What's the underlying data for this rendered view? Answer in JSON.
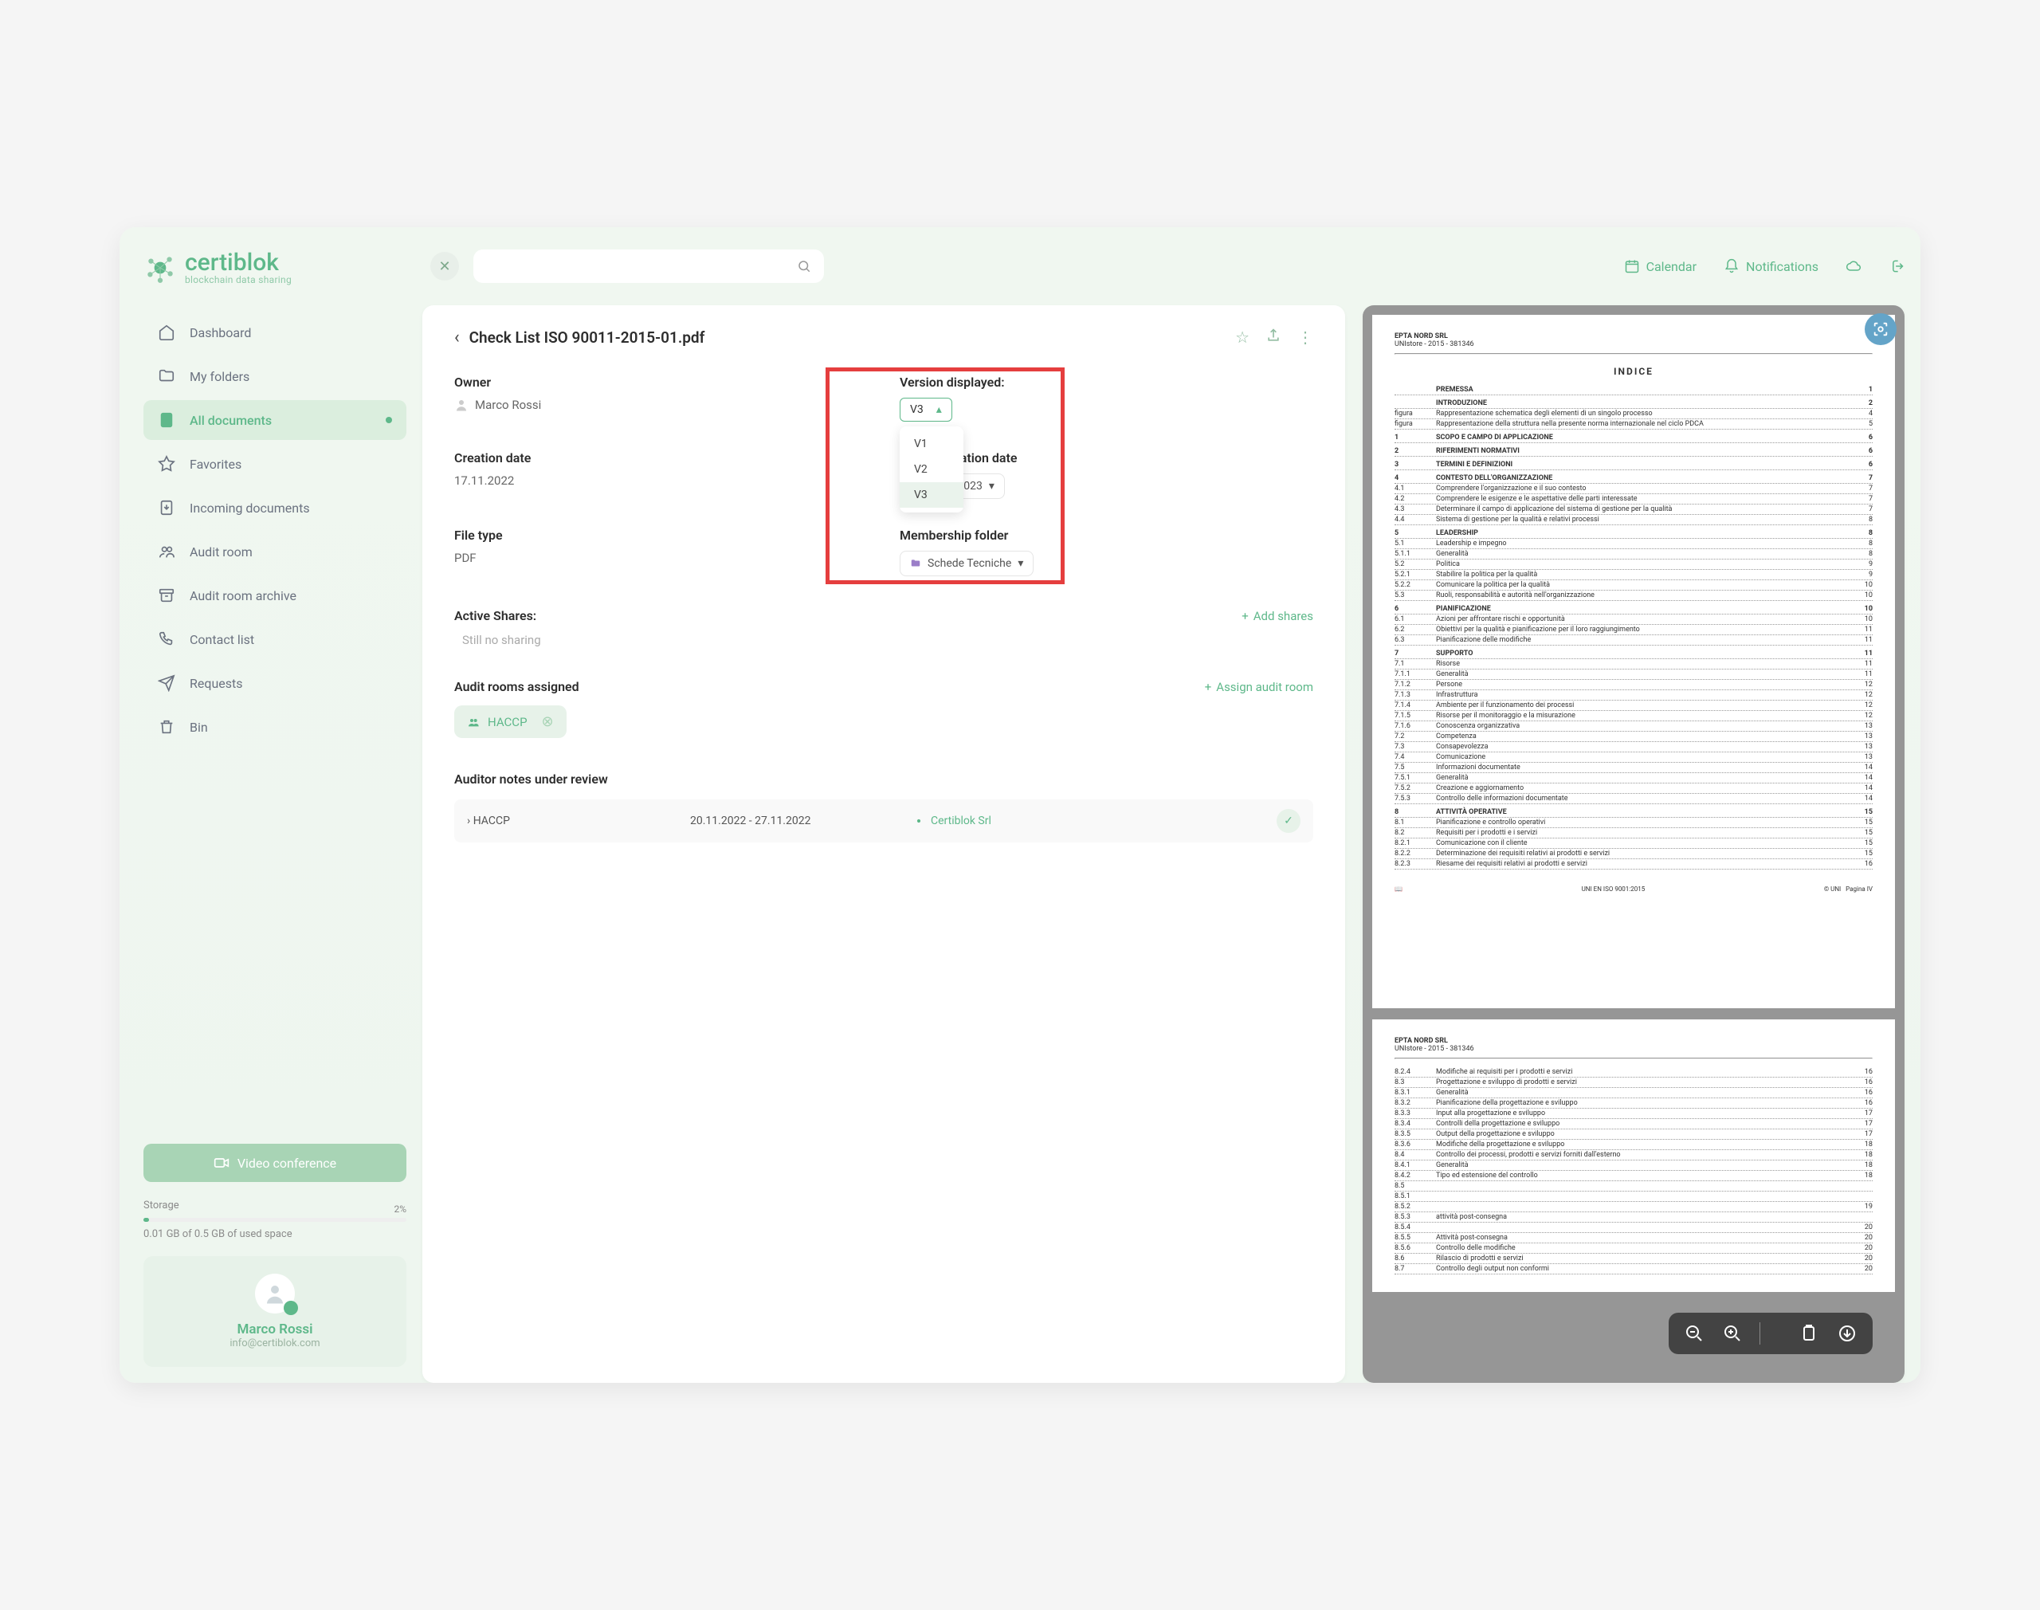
{
  "logo": {
    "name": "certiblok",
    "sub": "blockchain data sharing"
  },
  "nav": [
    {
      "id": "dashboard",
      "label": "Dashboard"
    },
    {
      "id": "folders",
      "label": "My folders"
    },
    {
      "id": "alldocs",
      "label": "All documents",
      "active": true,
      "dot": true
    },
    {
      "id": "favorites",
      "label": "Favorites"
    },
    {
      "id": "incoming",
      "label": "Incoming documents"
    },
    {
      "id": "auditroom",
      "label": "Audit room"
    },
    {
      "id": "archive",
      "label": "Audit room archive"
    },
    {
      "id": "contacts",
      "label": "Contact list"
    },
    {
      "id": "requests",
      "label": "Requests"
    },
    {
      "id": "bin",
      "label": "Bin"
    }
  ],
  "vc_label": "Video conference",
  "storage": {
    "label": "Storage",
    "pct": "2%",
    "text": "0.01 GB of 0.5 GB of used space"
  },
  "profile": {
    "name": "Marco Rossi",
    "email": "info@certiblok.com"
  },
  "topbar": {
    "calendar": "Calendar",
    "notifications": "Notifications"
  },
  "doc": {
    "title": "Check List ISO 90011-2015-01.pdf",
    "owner_label": "Owner",
    "owner": "Marco Rossi",
    "version_label": "Version displayed:",
    "version_selected": "V3",
    "version_options": [
      "V1",
      "V2",
      "V3"
    ],
    "creation_label": "Creation date",
    "creation": "17.11.2022",
    "expiration_label": "Expiration date",
    "expiration": "01.2023",
    "filetype_label": "File type",
    "filetype": "PDF",
    "membership_label": "Membership folder",
    "membership": "Schede Tecniche",
    "shares_label": "Active Shares:",
    "shares_add": "Add shares",
    "shares_none": "Still no sharing",
    "rooms_label": "Audit rooms assigned",
    "rooms_add": "Assign audit room",
    "room_tag": "HACCP",
    "notes_label": "Auditor notes under review",
    "notes": {
      "name": "HACCP",
      "dates": "20.11.2022 - 27.11.2022",
      "company": "Certiblok Srl"
    }
  },
  "preview": {
    "header": "EPTA NORD SRL",
    "subheader": "UNIstore - 2015 - 381346",
    "indice": "INDICE",
    "footer_std": "UNI EN ISO 9001:2015",
    "footer_right": "Pagina IV",
    "footer_uni": "© UNI",
    "toc": [
      {
        "n": "",
        "t": "PREMESSA",
        "p": "1",
        "h": 1
      },
      {
        "n": "",
        "t": "INTRODUZIONE",
        "p": "2",
        "h": 1
      },
      {
        "n": "figura",
        "t": "Rappresentazione schematica degli elementi di un singolo processo",
        "p": "4"
      },
      {
        "n": "figura",
        "t": "Rappresentazione della struttura nella presente norma internazionale nel ciclo PDCA",
        "p": "5"
      },
      {
        "n": "1",
        "t": "SCOPO E CAMPO DI APPLICAZIONE",
        "p": "6",
        "h": 1
      },
      {
        "n": "2",
        "t": "RIFERIMENTI NORMATIVI",
        "p": "6",
        "h": 1
      },
      {
        "n": "3",
        "t": "TERMINI E DEFINIZIONI",
        "p": "6",
        "h": 1
      },
      {
        "n": "4",
        "t": "CONTESTO DELL'ORGANIZZAZIONE",
        "p": "7",
        "h": 1
      },
      {
        "n": "4.1",
        "t": "Comprendere l'organizzazione e il suo contesto",
        "p": "7"
      },
      {
        "n": "4.2",
        "t": "Comprendere le esigenze e le aspettative delle parti interessate",
        "p": "7"
      },
      {
        "n": "4.3",
        "t": "Determinare il campo di applicazione del sistema di gestione per la qualità",
        "p": "7"
      },
      {
        "n": "4.4",
        "t": "Sistema di gestione per la qualità e relativi processi",
        "p": "8"
      },
      {
        "n": "5",
        "t": "LEADERSHIP",
        "p": "8",
        "h": 1
      },
      {
        "n": "5.1",
        "t": "Leadership e impegno",
        "p": "8"
      },
      {
        "n": "5.1.1",
        "t": "Generalità",
        "p": "8"
      },
      {
        "n": "5.2",
        "t": "Politica",
        "p": "9"
      },
      {
        "n": "5.2.1",
        "t": "Stabilire la politica per la qualità",
        "p": "9"
      },
      {
        "n": "5.2.2",
        "t": "Comunicare la politica per la qualità",
        "p": "10"
      },
      {
        "n": "5.3",
        "t": "Ruoli, responsabilità e autorità nell'organizzazione",
        "p": "10"
      },
      {
        "n": "6",
        "t": "PIANIFICAZIONE",
        "p": "10",
        "h": 1
      },
      {
        "n": "6.1",
        "t": "Azioni per affrontare rischi e opportunità",
        "p": "10"
      },
      {
        "n": "6.2",
        "t": "Obiettivi per la qualità e pianificazione per il loro raggiungimento",
        "p": "11"
      },
      {
        "n": "6.3",
        "t": "Pianificazione delle modifiche",
        "p": "11"
      },
      {
        "n": "7",
        "t": "SUPPORTO",
        "p": "11",
        "h": 1
      },
      {
        "n": "7.1",
        "t": "Risorse",
        "p": "11"
      },
      {
        "n": "7.1.1",
        "t": "Generalità",
        "p": "11"
      },
      {
        "n": "7.1.2",
        "t": "Persone",
        "p": "12"
      },
      {
        "n": "7.1.3",
        "t": "Infrastruttura",
        "p": "12"
      },
      {
        "n": "7.1.4",
        "t": "Ambiente per il funzionamento dei processi",
        "p": "12"
      },
      {
        "n": "7.1.5",
        "t": "Risorse per il monitoraggio e la misurazione",
        "p": "12"
      },
      {
        "n": "7.1.6",
        "t": "Conoscenza organizzativa",
        "p": "13"
      },
      {
        "n": "7.2",
        "t": "Competenza",
        "p": "13"
      },
      {
        "n": "7.3",
        "t": "Consapevolezza",
        "p": "13"
      },
      {
        "n": "7.4",
        "t": "Comunicazione",
        "p": "13"
      },
      {
        "n": "7.5",
        "t": "Informazioni documentate",
        "p": "14"
      },
      {
        "n": "7.5.1",
        "t": "Generalità",
        "p": "14"
      },
      {
        "n": "7.5.2",
        "t": "Creazione e aggiornamento",
        "p": "14"
      },
      {
        "n": "7.5.3",
        "t": "Controllo delle informazioni documentate",
        "p": "14"
      },
      {
        "n": "8",
        "t": "ATTIVITÀ OPERATIVE",
        "p": "15",
        "h": 1
      },
      {
        "n": "8.1",
        "t": "Pianificazione e controllo operativi",
        "p": "15"
      },
      {
        "n": "8.2",
        "t": "Requisiti per i prodotti e i servizi",
        "p": "15"
      },
      {
        "n": "8.2.1",
        "t": "Comunicazione con il cliente",
        "p": "15"
      },
      {
        "n": "8.2.2",
        "t": "Determinazione dei requisiti relativi ai prodotti e servizi",
        "p": "15"
      },
      {
        "n": "8.2.3",
        "t": "Riesame dei requisiti relativi ai prodotti e servizi",
        "p": "16"
      }
    ],
    "toc2": [
      {
        "n": "8.2.4",
        "t": "Modifiche ai requisiti per i prodotti e servizi",
        "p": "16"
      },
      {
        "n": "8.3",
        "t": "Progettazione e sviluppo di prodotti e servizi",
        "p": "16"
      },
      {
        "n": "8.3.1",
        "t": "Generalità",
        "p": "16"
      },
      {
        "n": "8.3.2",
        "t": "Pianificazione della progettazione e sviluppo",
        "p": "16"
      },
      {
        "n": "8.3.3",
        "t": "Input alla progettazione e sviluppo",
        "p": "17"
      },
      {
        "n": "8.3.4",
        "t": "Controlli della progettazione e sviluppo",
        "p": "17"
      },
      {
        "n": "8.3.5",
        "t": "Output della progettazione e sviluppo",
        "p": "17"
      },
      {
        "n": "8.3.6",
        "t": "Modifiche della progettazione e sviluppo",
        "p": "18"
      },
      {
        "n": "8.4",
        "t": "Controllo dei processi, prodotti e servizi forniti dall'esterno",
        "p": "18"
      },
      {
        "n": "8.4.1",
        "t": "Generalità",
        "p": "18"
      },
      {
        "n": "8.4.2",
        "t": "Tipo ed estensione del controllo",
        "p": "18"
      },
      {
        "n": "8.5",
        "t": "",
        "p": ""
      },
      {
        "n": "8.5.1",
        "t": "",
        "p": ""
      },
      {
        "n": "8.5.2",
        "t": "",
        "p": "19"
      },
      {
        "n": "8.5.3",
        "t": "attività post-consegna",
        "p": ""
      },
      {
        "n": "8.5.4",
        "t": "",
        "p": "20"
      },
      {
        "n": "8.5.5",
        "t": "Attività post-consegna",
        "p": "20"
      },
      {
        "n": "8.5.6",
        "t": "Controllo delle modifiche",
        "p": "20"
      },
      {
        "n": "8.6",
        "t": "Rilascio di prodotti e servizi",
        "p": "20"
      },
      {
        "n": "8.7",
        "t": "Controllo degli output non conformi",
        "p": "20"
      }
    ]
  }
}
